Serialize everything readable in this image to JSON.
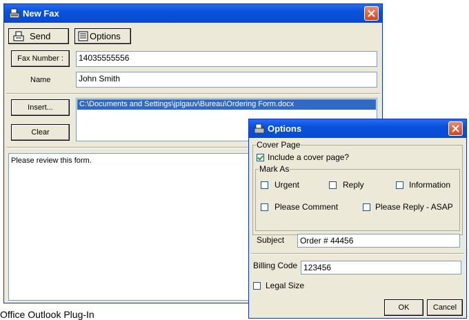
{
  "newfax": {
    "title": "New Fax",
    "toolbar": {
      "send_label": "Send",
      "options_label": "Options"
    },
    "fax_number_label": "Fax Number :",
    "fax_number_value": "14035555556",
    "name_label": "Name",
    "name_value": "John Smith",
    "insert_label": "Insert...",
    "clear_label": "Clear",
    "attachment": "C:\\Documents and Settings\\jplgauv\\Bureau\\Ordering Form.docx",
    "message_body": "Please review this form."
  },
  "options": {
    "title": "Options",
    "cover_page_group": "Cover Page",
    "include_cover_label": "Include a cover page?",
    "include_cover_checked": true,
    "mark_as_group": "Mark As",
    "marks": {
      "urgent": "Urgent",
      "reply": "Reply",
      "information": "Information",
      "please_comment": "Please Comment",
      "please_reply": "Please Reply - ASAP"
    },
    "subject_label": "Subject",
    "subject_value": "Order # 44456",
    "billing_label": "Billing Code",
    "billing_value": "123456",
    "legal_size_label": "Legal Size",
    "ok_label": "OK",
    "cancel_label": "Cancel"
  },
  "footer_text": "Office Outlook Plug-In",
  "colors": {
    "title_blue": "#0a49d1",
    "close_red": "#d14521",
    "dialog_bg": "#ece9d8",
    "selection_blue": "#316ac5"
  }
}
